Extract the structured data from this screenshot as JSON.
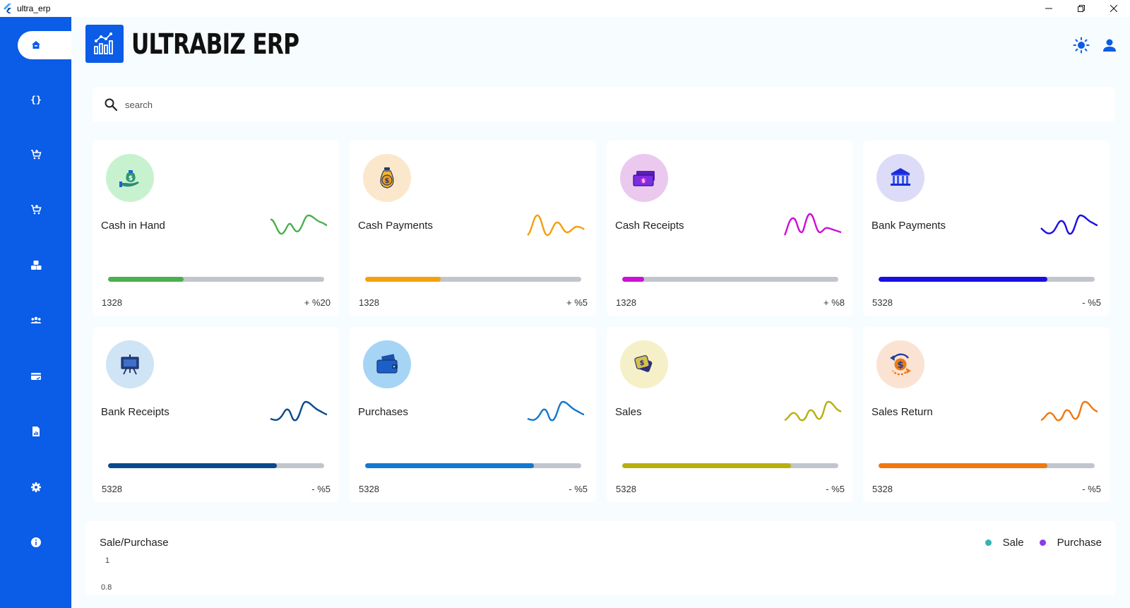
{
  "window": {
    "title": "ultra_erp"
  },
  "brand": {
    "name": "ULTRABIZ ERP",
    "primary_color": "#0b5ce6"
  },
  "sidebar": {
    "items": [
      {
        "icon": "home-icon",
        "active": true
      },
      {
        "icon": "code-braces-icon"
      },
      {
        "icon": "cart-add-icon"
      },
      {
        "icon": "cart-icon"
      },
      {
        "icon": "boxes-icon"
      },
      {
        "icon": "people-icon"
      },
      {
        "icon": "card-check-icon"
      },
      {
        "icon": "report-file-icon"
      },
      {
        "icon": "settings-icon"
      },
      {
        "icon": "info-icon"
      }
    ]
  },
  "search": {
    "placeholder": "search"
  },
  "cards": [
    {
      "title": "Cash in Hand",
      "value": "1328",
      "delta": "+ %20",
      "progress": 0.35,
      "color": "#4caf50",
      "icon_bg": "#c8f2cf",
      "icon": "money-bag-hand-icon"
    },
    {
      "title": "Cash Payments",
      "value": "1328",
      "delta": "+ %5",
      "progress": 0.35,
      "color": "#f5a00f",
      "icon_bg": "#fbe8cc",
      "icon": "coin-bag-icon"
    },
    {
      "title": "Cash Receipts",
      "value": "1328",
      "delta": "+ %8",
      "progress": 0.1,
      "color": "#cc10d6",
      "icon_bg": "#ebc9ef",
      "icon": "banknotes-icon"
    },
    {
      "title": "Bank Payments",
      "value": "5328",
      "delta": "- %5",
      "progress": 0.78,
      "color": "#1a0fe0",
      "icon_bg": "#dcdcf8",
      "icon": "bank-building-icon"
    },
    {
      "title": "Bank Receipts",
      "value": "5328",
      "delta": "- %5",
      "progress": 0.78,
      "color": "#0b4a8a",
      "icon_bg": "#cfe4f4",
      "icon": "presentation-board-icon"
    },
    {
      "title": "Purchases",
      "value": "5328",
      "delta": "- %5",
      "progress": 0.78,
      "color": "#1378cf",
      "icon_bg": "#a6d4f5",
      "icon": "wallet-icon"
    },
    {
      "title": "Sales",
      "value": "5328",
      "delta": "- %5",
      "progress": 0.78,
      "color": "#b8b010",
      "icon_bg": "#f5f0c8",
      "icon": "dollar-tags-icon"
    },
    {
      "title": "Sales Return",
      "value": "5328",
      "delta": "- %5",
      "progress": 0.78,
      "color": "#f07810",
      "icon_bg": "#fbe3d3",
      "icon": "dollar-return-icon"
    }
  ],
  "chart": {
    "title": "Sale/Purchase",
    "legend": [
      {
        "name": "Sale",
        "color": "#36b3b5"
      },
      {
        "name": "Purchase",
        "color": "#8b3be8"
      }
    ],
    "y_ticks": [
      "1",
      "0.8"
    ]
  },
  "chart_data": {
    "type": "line",
    "title": "Sale/Purchase",
    "series": [
      {
        "name": "Sale",
        "values": []
      },
      {
        "name": "Purchase",
        "values": []
      }
    ],
    "yticks": [
      1,
      0.8
    ],
    "legend": "top-right"
  }
}
